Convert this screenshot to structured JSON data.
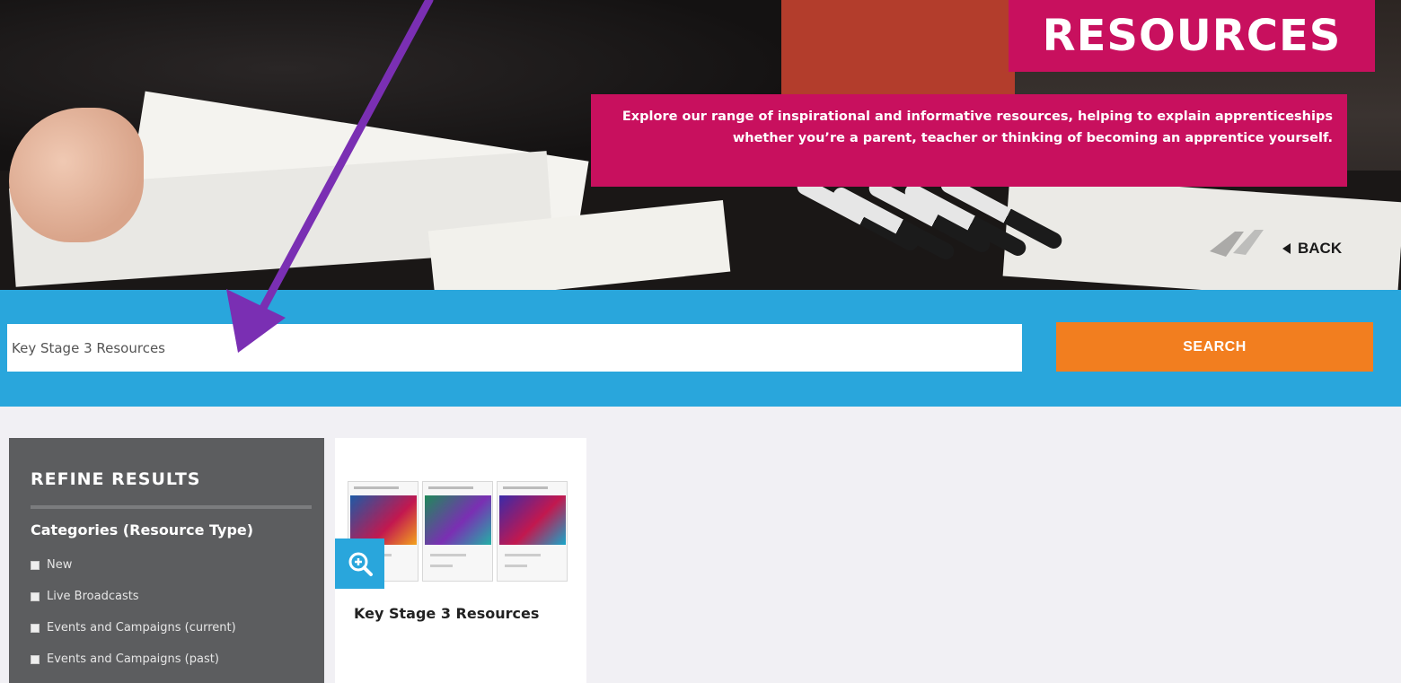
{
  "hero": {
    "title": "RESOURCES",
    "description": "Explore our range of inspirational and informative resources, helping to explain apprenticeships whether you’re a parent, teacher or thinking of becoming an apprentice yourself.",
    "back_label": "BACK"
  },
  "search": {
    "value": "Key Stage 3 Resources",
    "button_label": "SEARCH"
  },
  "sidebar": {
    "heading": "REFINE RESULTS",
    "group_title": "Categories (Resource Type)",
    "options": [
      "New",
      "Live Broadcasts",
      "Events and Campaigns (current)",
      "Events and Campaigns (past)"
    ]
  },
  "results": [
    {
      "title": "Key Stage 3 Resources"
    }
  ],
  "colors": {
    "magenta": "#c8105e",
    "blue": "#29a6dc",
    "orange": "#f27e1f",
    "sidebar_grey": "#5c5d5f",
    "annotation_arrow": "#7a2fb3"
  },
  "icons": {
    "zoom": "zoom-in-icon",
    "back": "back-triangle-icon",
    "annotation": "arrow-annotation"
  }
}
